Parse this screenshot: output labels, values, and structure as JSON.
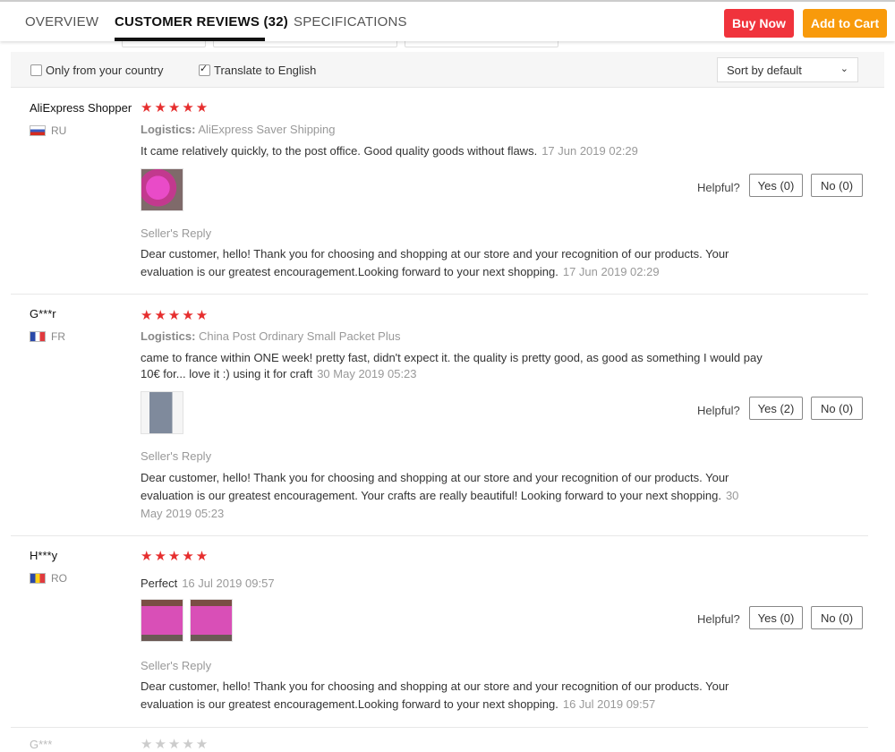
{
  "tabs": [
    {
      "label": "OVERVIEW"
    },
    {
      "label": "CUSTOMER REVIEWS (32)"
    },
    {
      "label": "SPECIFICATIONS"
    }
  ],
  "actions": {
    "buy_now": "Buy Now",
    "add_to_cart": "Add to Cart"
  },
  "filters": {
    "only_country": "Only from your country",
    "translate": "Translate to English",
    "sort": "Sort by default"
  },
  "colors": {
    "buy_now": "#f0333c",
    "add_to_cart": "#f89a0b",
    "stars": "#e62e2e"
  },
  "reviews": [
    {
      "user": "AliExpress Shopper",
      "country": "RU",
      "stars": "★★★★★",
      "logistics_label": "Logistics:",
      "logistics": "AliExpress Saver Shipping",
      "text": "It came relatively quickly, to the post office. Good quality goods without flaws.",
      "date": "17 Jun 2019 02:29",
      "helpful": "Helpful?",
      "yes": "Yes (0)",
      "no": "No (0)",
      "seller_title": "Seller's Reply",
      "reply": "Dear customer, hello! Thank you for choosing and shopping at our store and your recognition of our products. Your evaluation is our greatest encouragement.Looking forward to your next shopping.",
      "reply_date": "17 Jun 2019 02:29"
    },
    {
      "user": "G***r",
      "country": "FR",
      "stars": "★★★★★",
      "logistics_label": "Logistics:",
      "logistics": "China Post Ordinary Small Packet Plus",
      "text": "came to france within ONE week! pretty fast, didn't expect it. the quality is pretty good, as good as something I would pay 10€ for... love it :) using it for craft",
      "date": "30 May 2019 05:23",
      "helpful": "Helpful?",
      "yes": "Yes (2)",
      "no": "No (0)",
      "seller_title": "Seller's Reply",
      "reply": "Dear customer, hello! Thank you for choosing and shopping at our store and your recognition of our products. Your evaluation is our greatest encouragement. Your crafts are really beautiful! Looking forward to your next shopping.",
      "reply_date": "30 May 2019 05:23"
    },
    {
      "user": "H***y",
      "country": "RO",
      "stars": "★★★★★",
      "text": "Perfect",
      "date": "16 Jul 2019 09:57",
      "helpful": "Helpful?",
      "yes": "Yes (0)",
      "no": "No (0)",
      "seller_title": "Seller's Reply",
      "reply": "Dear customer, hello! Thank you for choosing and shopping at our store and your recognition of our products. Your evaluation is our greatest encouragement.Looking forward to your next shopping.",
      "reply_date": "16 Jul 2019 09:57"
    }
  ],
  "next_review": {
    "user": "G***",
    "stars": "★★★★★"
  }
}
